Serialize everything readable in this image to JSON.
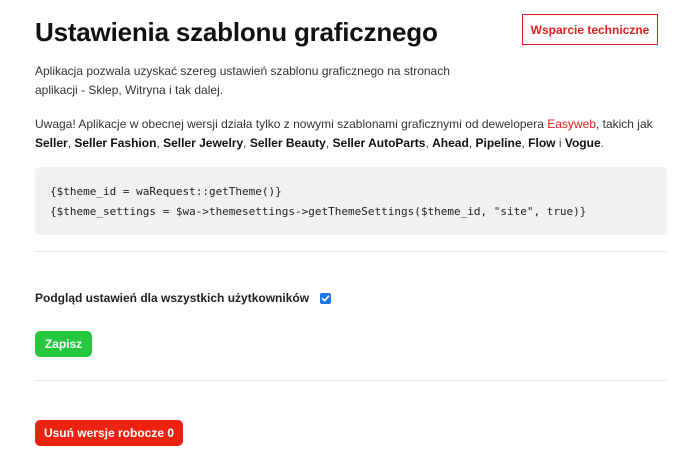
{
  "header": {
    "title": "Ustawienia szablonu graficznego",
    "support_label": "Wsparcie techniczne"
  },
  "description": {
    "line1": "Aplikacja pozwala uzyskać szereg ustawień szablonu graficznego na stronach",
    "line2": "aplikacji - Sklep, Witryna i tak dalej."
  },
  "warning": {
    "prefix": "Uwaga! Aplikacje w obecnej wersji działa tylko z nowymi szablonami graficznymi od dewelopera ",
    "developer_link": "Easyweb",
    "after_link": ", takich jak ",
    "themes": [
      "Seller",
      "Seller Fashion",
      "Seller Jewelry",
      "Seller Beauty",
      "Seller AutoParts",
      "Ahead",
      "Pipeline",
      "Flow"
    ],
    "sep": ", ",
    "conjunction": " i ",
    "last_theme": "Vogue",
    "end": "."
  },
  "code": {
    "line1": "{$theme_id = waRequest::getTheme()}",
    "line2": "{$theme_settings = $wa->themesettings->getThemeSettings($theme_id, \"site\", true)}"
  },
  "preview": {
    "label": "Podgląd ustawień dla wszystkich użytkowników",
    "checked": true
  },
  "actions": {
    "save_label": "Zapisz",
    "delete_drafts_label": "Usuń wersje robocze 0"
  },
  "colors": {
    "accent_red": "#e02020",
    "save_green": "#25c73f",
    "delete_red": "#ee2211",
    "checkbox_blue": "#1a73e8"
  }
}
